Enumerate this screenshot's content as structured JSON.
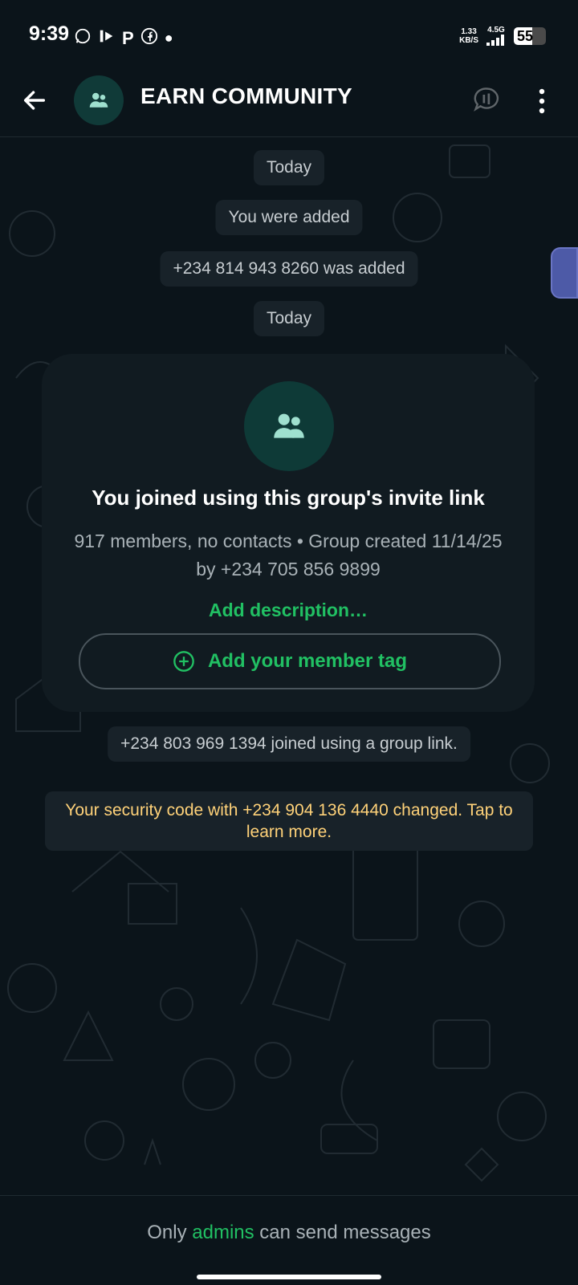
{
  "status_bar": {
    "time": "9:39",
    "net_speed": "1.33",
    "net_unit": "KB/S",
    "network": "4.5G",
    "battery": "55",
    "icons": [
      "whatsapp-icon",
      "media-icon",
      "parking-app-icon",
      "facebook-icon",
      "dot-icon",
      "signal-icon",
      "battery-icon"
    ]
  },
  "header": {
    "title": "EARN COMMUNITY",
    "back_icon": "back-arrow-icon",
    "avatar_icon": "group-icon",
    "call_icon": "voice-chat-icon",
    "menu_icon": "more-vertical-icon"
  },
  "chat": {
    "date_label_1": "Today",
    "system_1": "You were added",
    "system_2": "+234 814 943 8260 was added",
    "date_label_2": "Today",
    "card": {
      "title": "You joined using this group's invite link",
      "subtitle": "917 members, no contacts • Group created 11/14/25 by +234 705 856 9899",
      "add_description": "Add description…",
      "member_tag_button": "Add your member tag"
    },
    "system_3": "+234 803 969 1394 joined using a group link.",
    "security_notice": "Your security code with +234 904 136 4440 changed. Tap to learn more."
  },
  "footer": {
    "prefix": "Only",
    "admins": "admins",
    "suffix": "can send messages"
  },
  "colors": {
    "background": "#0b141a",
    "accent_green": "#21c063",
    "bubble": "#182229",
    "card": "#111b21",
    "security_text": "#ffd279"
  }
}
